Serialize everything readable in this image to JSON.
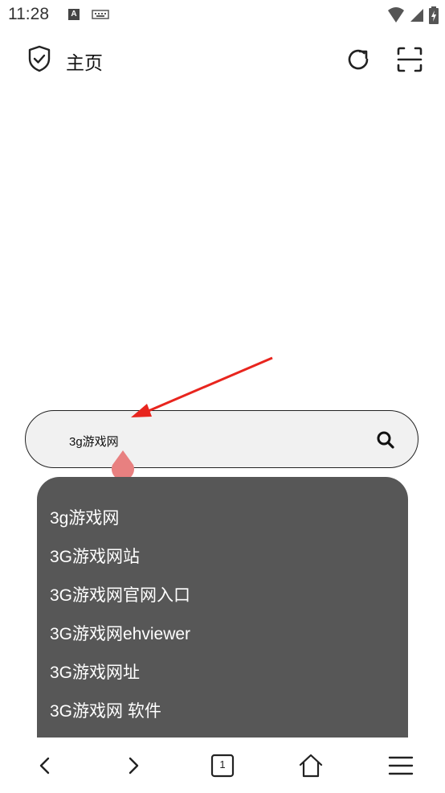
{
  "status_bar": {
    "time": "11:28",
    "left_icons": [
      "a-icon",
      "keyboard-icon"
    ],
    "right_icons": [
      "wifi-icon",
      "signal-icon",
      "battery-icon"
    ]
  },
  "app_bar": {
    "title": "主页",
    "icons": [
      "shield-check-icon",
      "reload-icon",
      "scan-icon"
    ]
  },
  "search": {
    "value": "3g游戏网"
  },
  "suggestions": [
    "3g游戏网",
    "3G游戏网站",
    "3G游戏网官网入口",
    "3G游戏网ehviewer",
    "3G游戏网址",
    "3G游戏网 软件"
  ],
  "bottom_nav": {
    "tab_count": "1",
    "icons": [
      "back-icon",
      "forward-icon",
      "tabs-icon",
      "home-icon",
      "menu-icon"
    ]
  },
  "colors": {
    "suggestion_bg": "#575757",
    "search_bg": "#f1f1f1",
    "annotation_arrow": "#e8251e",
    "cursor_handle": "#e88080"
  }
}
